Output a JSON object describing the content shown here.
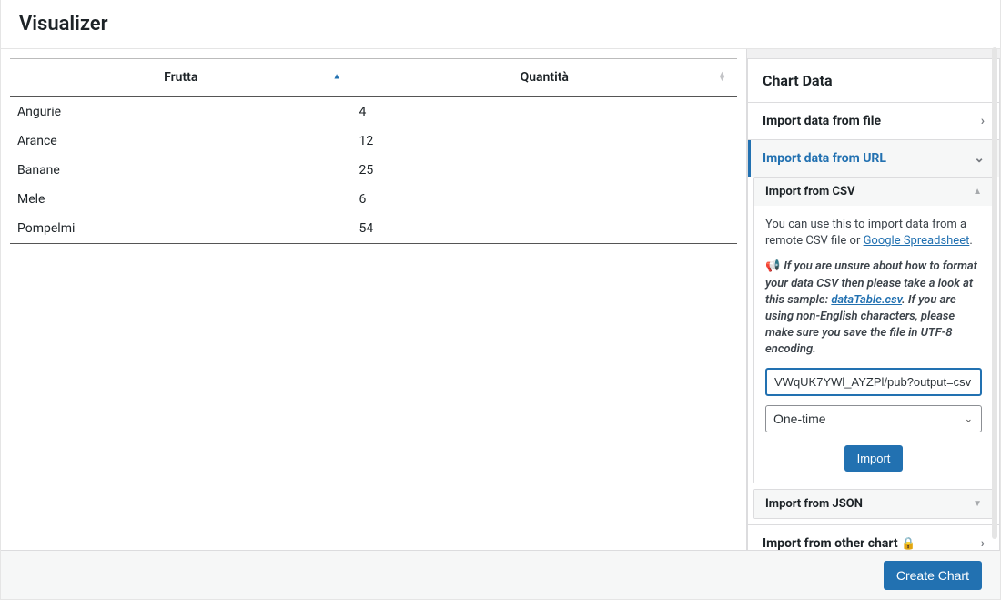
{
  "header": {
    "title": "Visualizer"
  },
  "table": {
    "columns": [
      "Frutta",
      "Quantità"
    ],
    "sorted_col": 0,
    "rows": [
      {
        "c0": "Angurie",
        "c1": "4"
      },
      {
        "c0": "Arance",
        "c1": "12"
      },
      {
        "c0": "Banane",
        "c1": "25"
      },
      {
        "c0": "Mele",
        "c1": "6"
      },
      {
        "c0": "Pompelmi",
        "c1": "54"
      }
    ]
  },
  "panel": {
    "title": "Chart Data",
    "items": {
      "from_file": "Import data from file",
      "from_url": "Import data from URL",
      "from_other": "Import from other chart"
    },
    "csv": {
      "title": "Import from CSV",
      "help1a": "You can use this to import data from a remote CSV file or ",
      "help1b": "Google Spreadsheet",
      "hint1": "If you are unsure about how to format your data CSV then please take a look at this sample: ",
      "hint_link": "dataTable.csv",
      "hint2": ". If you are using non-English characters, please make sure you save the file in UTF-8 encoding.",
      "url_value": "VWqUK7YWl_AYZPl/pub?output=csv",
      "freq_value": "One-time",
      "import_btn": "Import"
    },
    "json": {
      "title": "Import from JSON"
    }
  },
  "footer": {
    "create_btn": "Create Chart"
  },
  "chart_data": {
    "type": "table",
    "columns": [
      "Frutta",
      "Quantità"
    ],
    "rows": [
      [
        "Angurie",
        4
      ],
      [
        "Arance",
        12
      ],
      [
        "Banane",
        25
      ],
      [
        "Mele",
        6
      ],
      [
        "Pompelmi",
        54
      ]
    ]
  }
}
